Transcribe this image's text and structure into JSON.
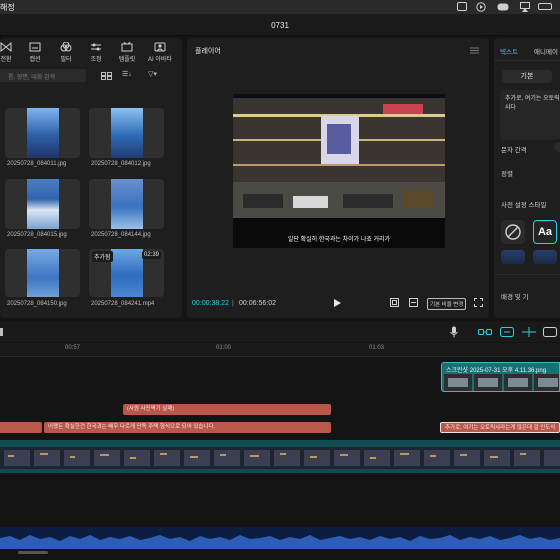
{
  "menubar": {
    "title_fragment": "해정"
  },
  "window": {
    "title": "0731"
  },
  "media_panel": {
    "tools": [
      {
        "icon": "transition-icon",
        "label": "전환"
      },
      {
        "icon": "caption-icon",
        "label": "캡션"
      },
      {
        "icon": "filter-icon",
        "label": "필터"
      },
      {
        "icon": "adjust-icon",
        "label": "조정"
      },
      {
        "icon": "template-icon",
        "label": "템플릿"
      },
      {
        "icon": "ai-avatar-icon",
        "label": "AI 아바타"
      }
    ],
    "search_placeholder": "름, 장면, 대화 검색",
    "filter_labels": [
      "☰↓",
      "▽▾"
    ],
    "items": [
      {
        "name": "20250728_084011.jpg",
        "badge": ""
      },
      {
        "name": "20250728_084012.jpg",
        "badge": ""
      },
      {
        "name": "20250728_084015.jpg",
        "badge": ""
      },
      {
        "name": "20250728_084144.jpg",
        "badge": ""
      },
      {
        "name": "20250728_084150.jpg",
        "badge": ""
      },
      {
        "name": "20250728_084241.mp4",
        "badge": "추가됨",
        "duration": "02:39"
      }
    ]
  },
  "player": {
    "title": "플레이어",
    "subtitle": "일단 확실히 한국과는 차이가 나죠 거리가",
    "time_current": "00:00:38:22",
    "time_total": "00:06:56:02",
    "ratio_label": "기본 비율 변경"
  },
  "inspector": {
    "tabs": [
      "텍스트",
      "애니메이"
    ],
    "basic_tab": "기본",
    "text_value": "추가로, 여기는 오토릭샤다",
    "letter_spacing_label": "문자 간격",
    "align_label": "정렬",
    "preset_label": "사전 설정 스타일",
    "preset_text": "Aa",
    "bottom_label": "배경 및 기"
  },
  "timeline": {
    "ruler": [
      "00:57",
      "01:00",
      "01:03"
    ],
    "title_clip_1": "(사원 사진찍기 실패)",
    "title_clip_2": "어쨌든 확실한건 한국과는 배우 다르게 단독 주택 형식으로 되어 있습니다.",
    "title_clip_3": "추가로, 여기는 오토릭샤라는게 많은데 걸 인도식",
    "image_clip_label": "스크린샷 2025-07-31 오후 4.11.36.png"
  },
  "colors": {
    "accent": "#2ad0e0",
    "title_clip": "#b9574b",
    "main_track": "#0f4c52",
    "audio_track": "#0c1d40"
  }
}
